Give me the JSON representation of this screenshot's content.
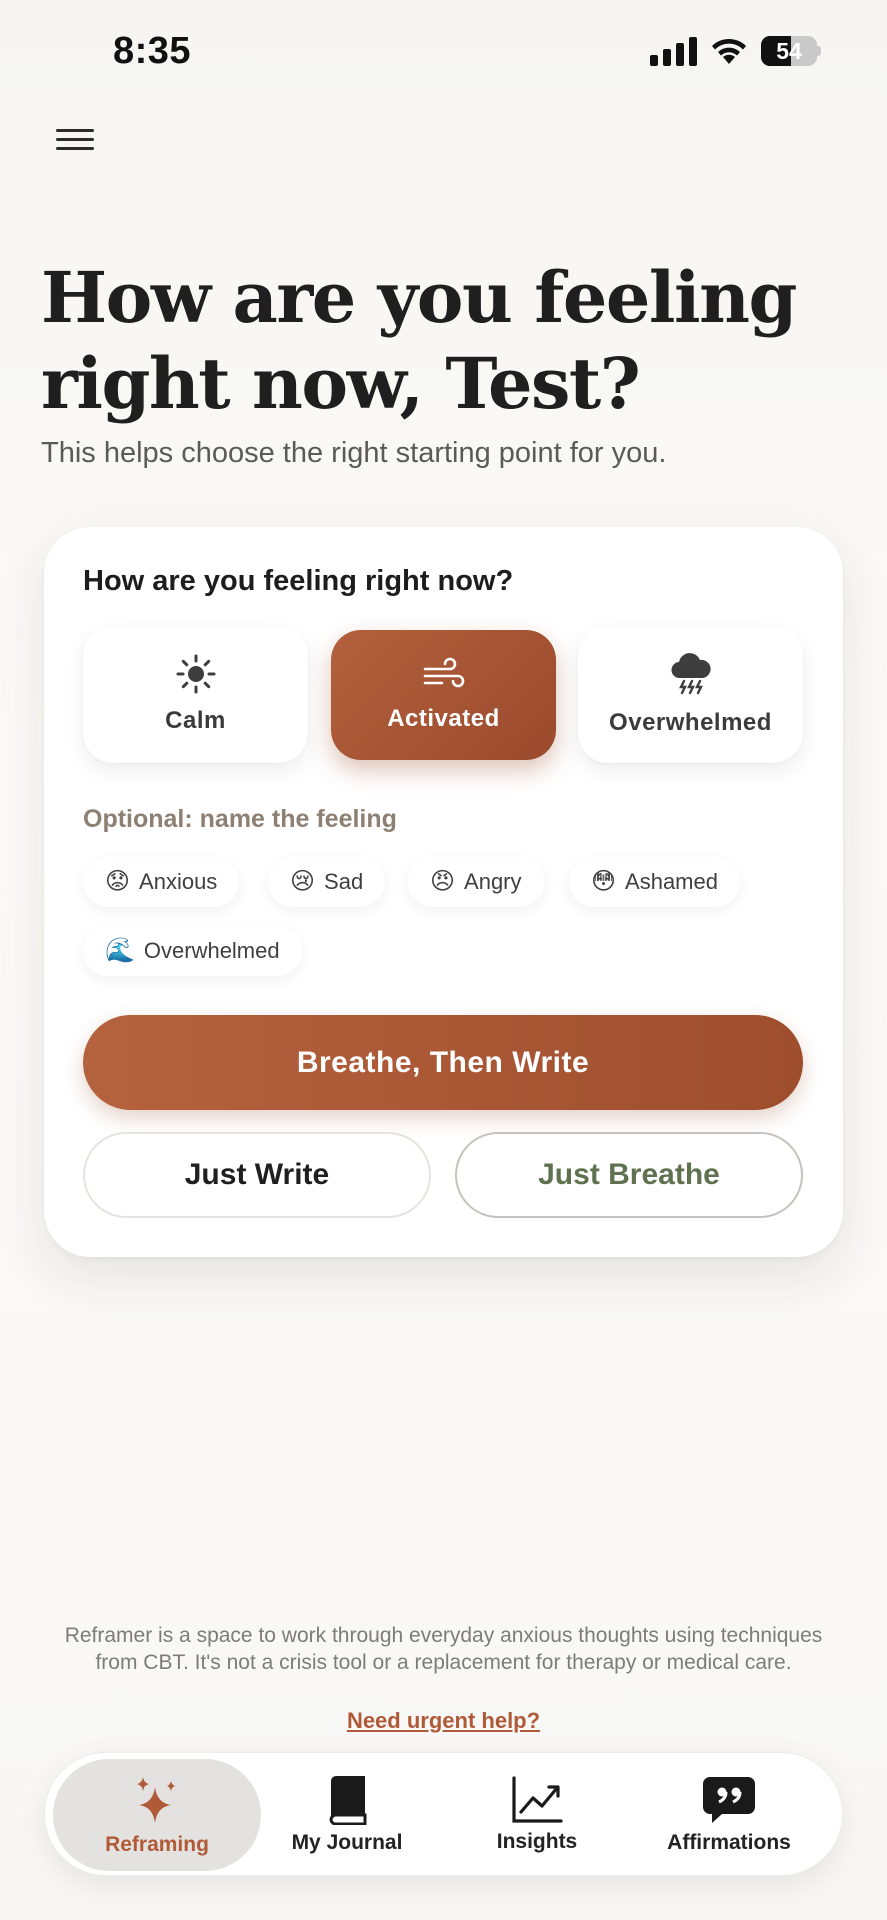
{
  "status_bar": {
    "time": "8:35",
    "battery_level": "54",
    "battery_fraction": 0.54,
    "icons": [
      "signal-icon",
      "wifi-icon",
      "battery-icon"
    ]
  },
  "header": {
    "menu_icon": "hamburger-menu-icon"
  },
  "page": {
    "title_line1": "How are you feeling",
    "title_line2": "right now, Test?",
    "subtitle": "This helps choose the right starting point for you."
  },
  "card": {
    "question": "How are you feeling right now?",
    "moods": [
      {
        "label": "Calm",
        "icon": "sun-icon",
        "selected": false
      },
      {
        "label": "Activated",
        "icon": "wind-icon",
        "selected": true
      },
      {
        "label": "Overwhelmed",
        "icon": "storm-cloud-icon",
        "selected": false
      }
    ],
    "optional_label": "Optional: name the feeling",
    "feelings": [
      {
        "emoji": "😟",
        "label": "Anxious"
      },
      {
        "emoji": "😢",
        "label": "Sad"
      },
      {
        "emoji": "😠",
        "label": "Angry"
      },
      {
        "emoji": "😳",
        "label": "Ashamed"
      },
      {
        "emoji": "🌊",
        "label": "Overwhelmed"
      }
    ],
    "primary_action": "Breathe, Then Write",
    "secondary_actions": [
      "Just Write",
      "Just Breathe"
    ]
  },
  "footer": {
    "disclaimer": "Reframer is a space to work through everyday anxious thoughts using techniques from CBT. It's not a crisis tool or a replacement for therapy or medical care.",
    "urgent_link": "Need urgent help?"
  },
  "tabs": [
    {
      "label": "Reframing",
      "icon": "sparkle-icon",
      "active": true
    },
    {
      "label": "My Journal",
      "icon": "book-icon",
      "active": false
    },
    {
      "label": "Insights",
      "icon": "trend-chart-icon",
      "active": false
    },
    {
      "label": "Affirmations",
      "icon": "quote-bubble-icon",
      "active": false
    }
  ],
  "colors": {
    "accent": "#a8573a",
    "accent_text": "#b05a38",
    "green_text": "#5f7250",
    "background": "#f8f7f5"
  }
}
